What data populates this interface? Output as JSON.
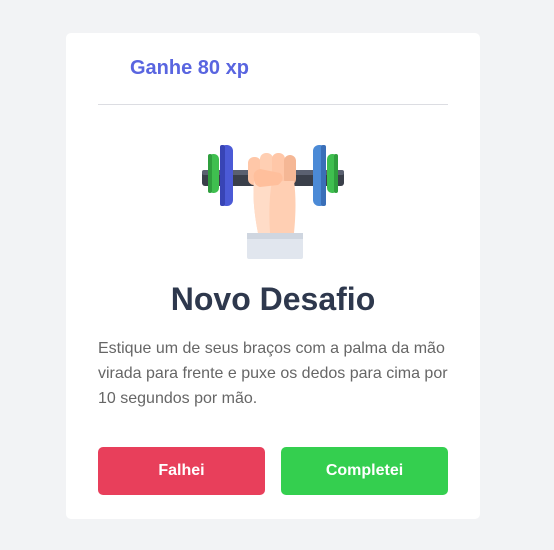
{
  "challenge": {
    "xp_text": "Ganhe 80 xp",
    "icon": "dumbbell-hand-icon",
    "title": "Novo Desafio",
    "description": "Estique um de seus braços com a palma da mão virada para frente e puxe os dedos para cima por 10 segundos por mão.",
    "fail_label": "Falhei",
    "success_label": "Completei"
  },
  "colors": {
    "accent": "#5965e0",
    "fail": "#e83f5b",
    "success": "#34cf4f",
    "title": "#2e384d",
    "text": "#666666",
    "background": "#f2f3f5"
  }
}
